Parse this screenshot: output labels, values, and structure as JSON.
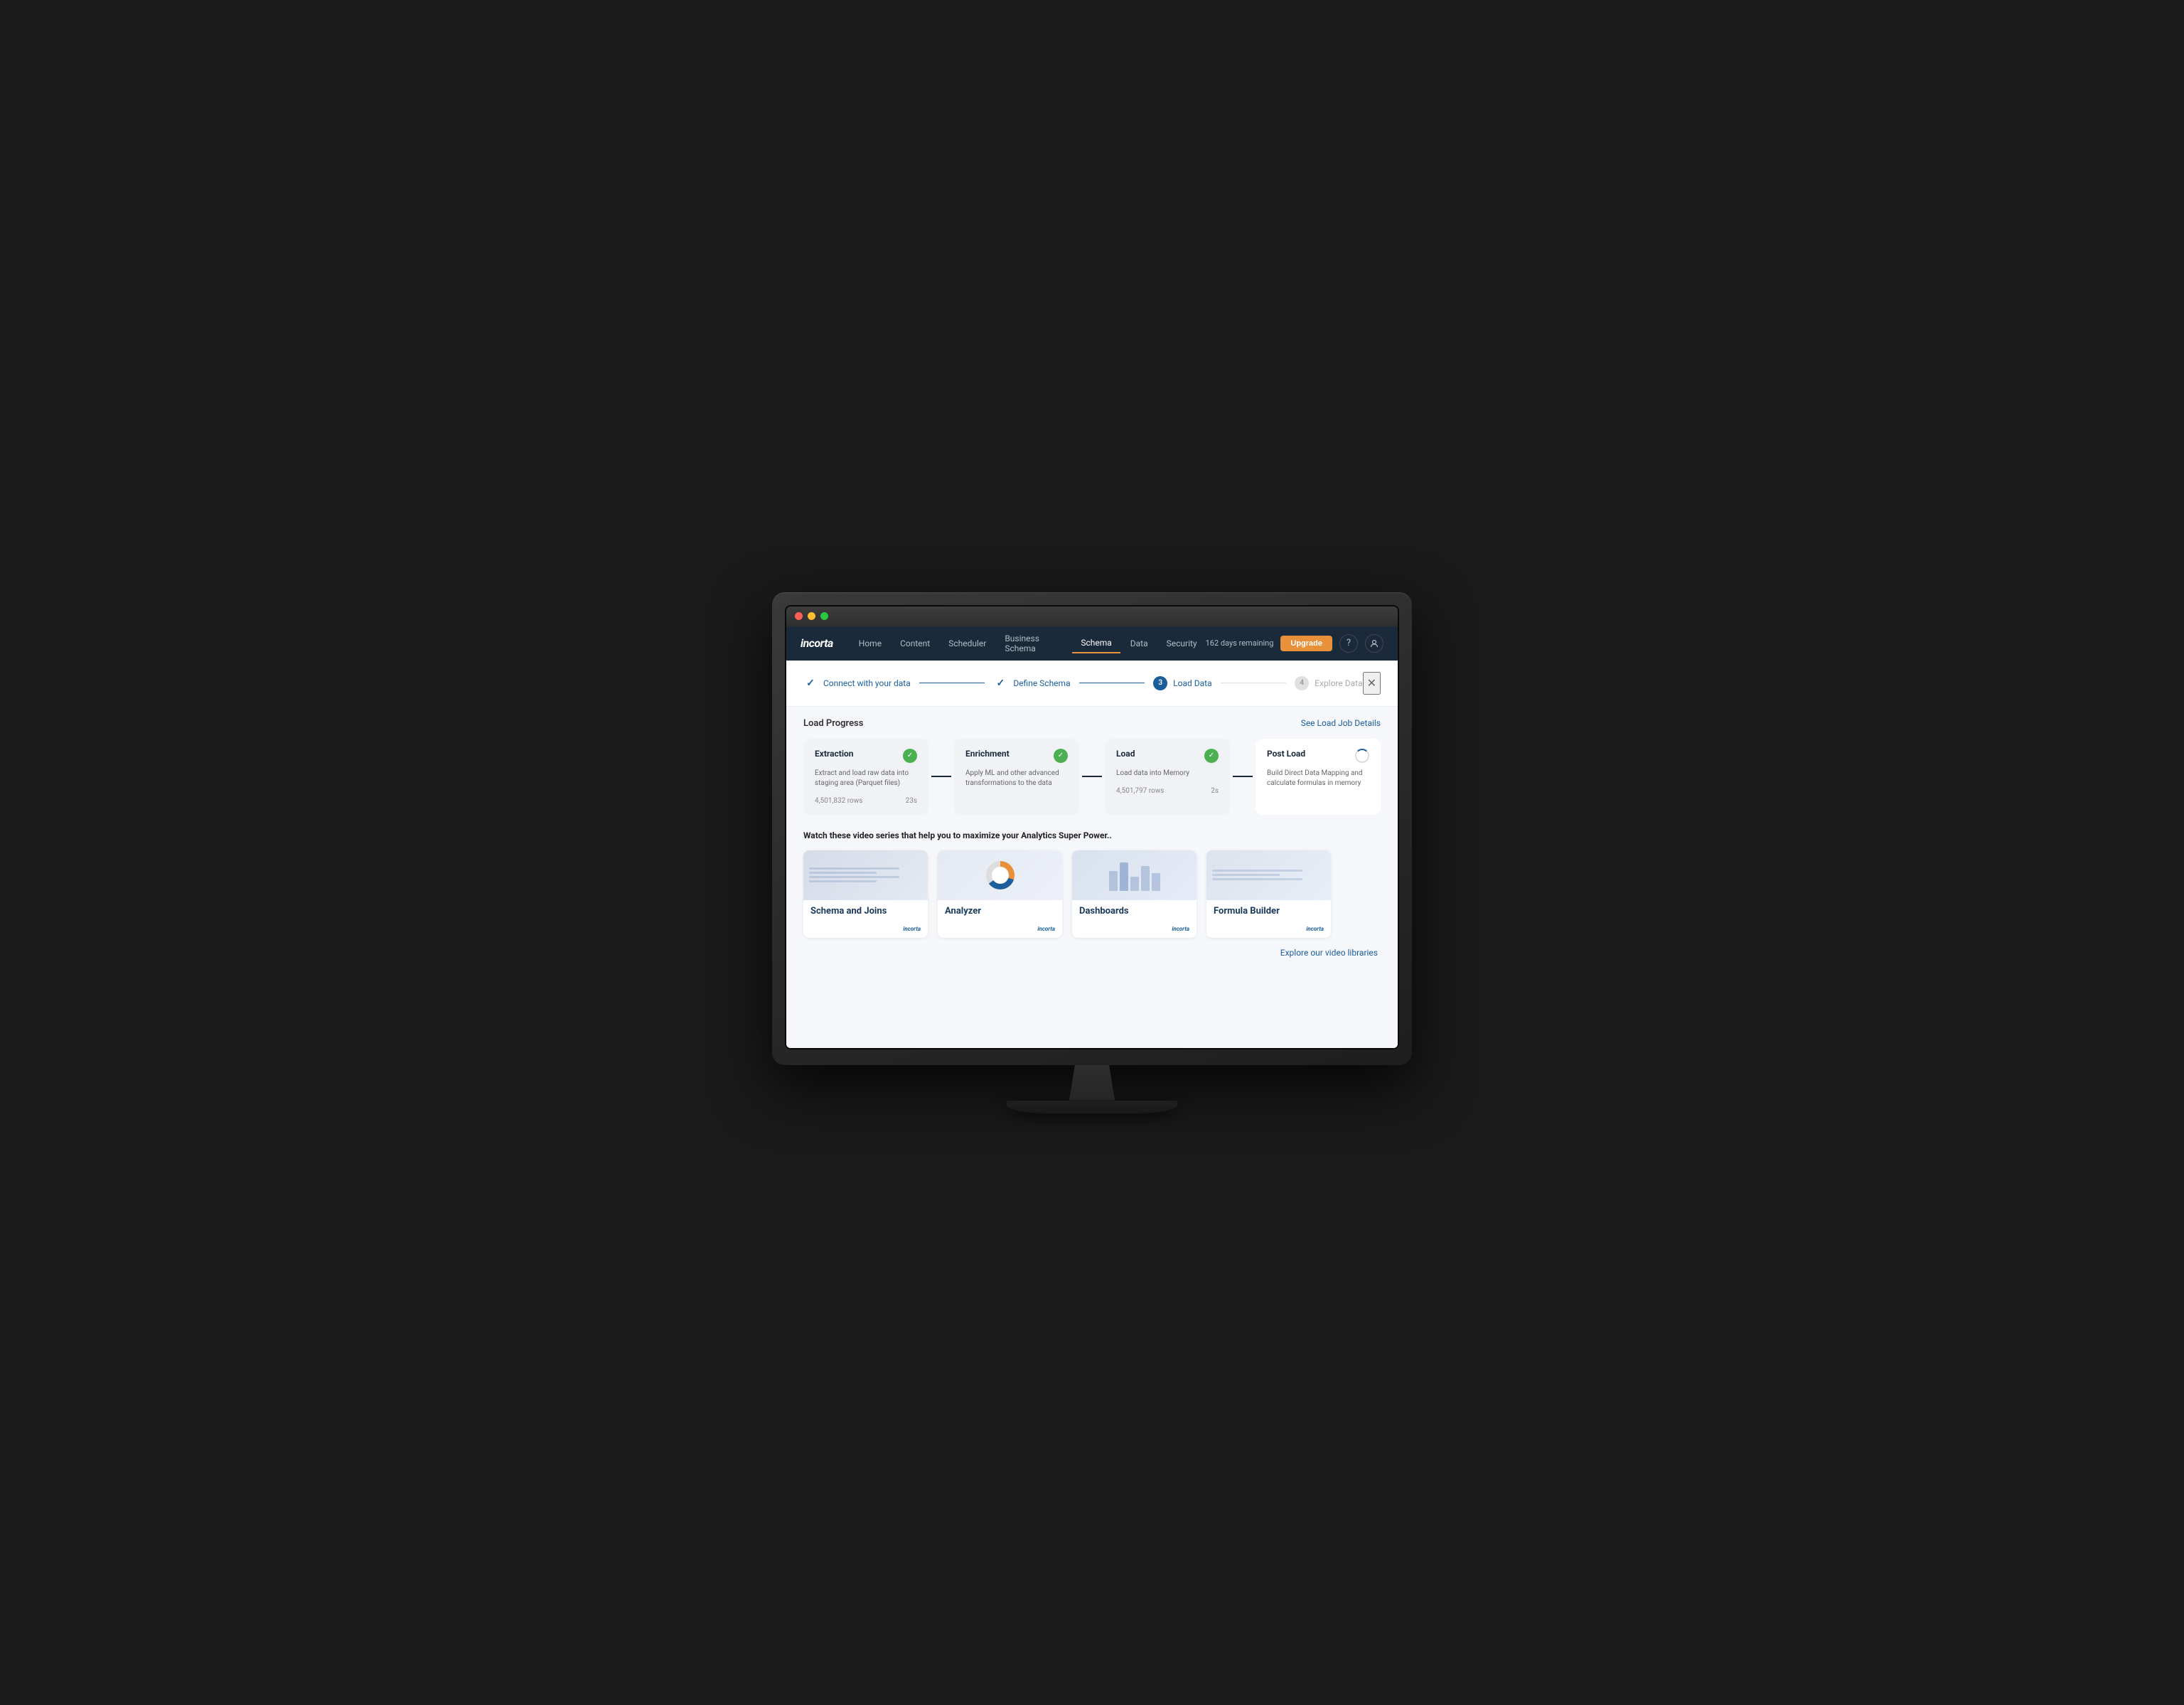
{
  "app": {
    "title": "Incorta"
  },
  "nav": {
    "logo": "incorta",
    "items": [
      {
        "label": "Home",
        "active": false
      },
      {
        "label": "Content",
        "active": false
      },
      {
        "label": "Scheduler",
        "active": false
      },
      {
        "label": "Business Schema",
        "active": false
      },
      {
        "label": "Schema",
        "active": true
      },
      {
        "label": "Data",
        "active": false
      },
      {
        "label": "Security",
        "active": false
      }
    ],
    "days_remaining": "162 days remaining",
    "upgrade_label": "Upgrade"
  },
  "wizard": {
    "steps": [
      {
        "label": "Connect with your data",
        "state": "completed",
        "icon": "✓"
      },
      {
        "label": "Define Schema",
        "state": "completed",
        "icon": "✓"
      },
      {
        "label": "Load Data",
        "state": "active",
        "number": "3"
      },
      {
        "label": "Explore Data",
        "state": "inactive",
        "number": "4"
      }
    ]
  },
  "load_progress": {
    "title": "Load Progress",
    "see_details_label": "See Load Job Details",
    "cards": [
      {
        "title": "Extraction",
        "description": "Extract and load raw data into staging area (Parquet files)",
        "rows": "4,501,832 rows",
        "time": "23s",
        "state": "completed"
      },
      {
        "title": "Enrichment",
        "description": "Apply ML and other advanced transformations to the data",
        "rows": "",
        "time": "",
        "state": "completed"
      },
      {
        "title": "Load",
        "description": "Load data into Memory",
        "rows": "4,501,797 rows",
        "time": "2s",
        "state": "completed"
      },
      {
        "title": "Post Load",
        "description": "Build Direct Data Mapping and calculate formulas in memory",
        "state": "loading"
      }
    ]
  },
  "videos": {
    "intro_text": "Watch these video series that help you to maximize your Analytics Super Power..",
    "cards": [
      {
        "title": "Schema and Joins",
        "thumbnail_type": "lines"
      },
      {
        "title": "Analyzer",
        "thumbnail_type": "donut"
      },
      {
        "title": "Dashboards",
        "thumbnail_type": "bars"
      },
      {
        "title": "Formula Builder",
        "thumbnail_type": "lines2"
      }
    ],
    "explore_label": "Explore our video libraries",
    "incorta_brand": "incorta"
  }
}
